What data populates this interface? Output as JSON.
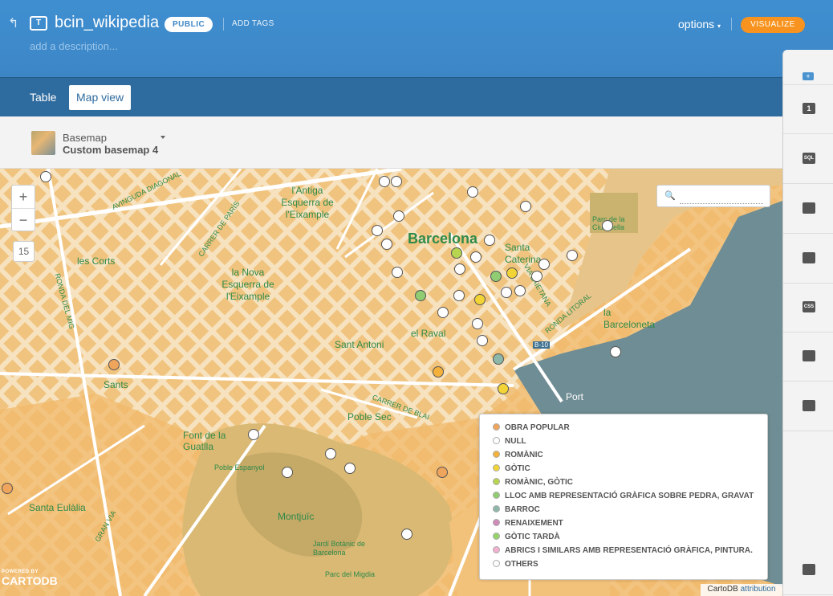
{
  "header": {
    "table_icon": "T",
    "title": "bcin_wikipedia",
    "privacy": "PUBLIC",
    "add_tags": "ADD TAGS",
    "description": "add a description...",
    "options": "options",
    "visualize": "VISUALIZE"
  },
  "tabs": [
    {
      "label": "Table"
    },
    {
      "label": "Map view"
    }
  ],
  "basemap": {
    "label": "Basemap",
    "name": "Custom basemap 4"
  },
  "map": {
    "zoom_in": "+",
    "zoom_out": "−",
    "zoom_level": "15",
    "search_placeholder": "",
    "labels": [
      "Barcelona",
      "l'Antiga Esquerra de l'Eixample",
      "la Nova Esquerra de l'Eixample",
      "les Corts",
      "Sants",
      "Sant Antoni",
      "el Raval",
      "Poble Sec",
      "Font de la Guatlla",
      "Montjuïc",
      "Santa Eulàlia",
      "la Barceloneta",
      "Santa Caterina",
      "Poble Espanyol",
      "Port",
      "Jardí Botànic de Barcelona",
      "Parc del Migdia",
      "AVINGUDA DIAGONAL",
      "RONDA DEL MIG",
      "CARRER DE PARÍS",
      "RONDA LITORAL",
      "VIA LAIETANA",
      "CARRER DE BLAI",
      "B-10",
      "GRAN VIA",
      "Parc de la Ciutadella"
    ],
    "attribution_prefix": "CartoDB",
    "attribution_link": "attribution",
    "powered_by": "POWERED BY",
    "brand": "CARTODB"
  },
  "legend": {
    "items": [
      {
        "label": "OBRA POPULAR",
        "color": "#f0a55d"
      },
      {
        "label": "NULL",
        "color": "#ffffff"
      },
      {
        "label": "ROMÀNIC",
        "color": "#f4b13b"
      },
      {
        "label": "GÒTIC",
        "color": "#f2d436"
      },
      {
        "label": "ROMÀNIC, GÒTIC",
        "color": "#b7d54f"
      },
      {
        "label": "LLOC AMB REPRESENTACIÓ GRÀFICA SOBRE PEDRA, GRAVAT",
        "color": "#8fcc72"
      },
      {
        "label": "BARROC",
        "color": "#8db7a9"
      },
      {
        "label": "RENAIXEMENT",
        "color": "#cf8bb8"
      },
      {
        "label": "GÒTIC TARDÀ",
        "color": "#96d36a"
      },
      {
        "label": "ABRICS I SIMILARS AMB REPRESENTACIÓ GRÀFICA, PINTURA.",
        "color": "#f2b1cf"
      },
      {
        "label": "OTHERS",
        "color": "#ffffff"
      }
    ]
  },
  "right_panel": {
    "buttons": [
      {
        "name": "add-layer",
        "label": "+"
      },
      {
        "name": "layer-1",
        "label": "1"
      },
      {
        "name": "sql",
        "label": "SQL"
      },
      {
        "name": "wizard",
        "label": ""
      },
      {
        "name": "infowindow",
        "label": ""
      },
      {
        "name": "css",
        "label": "CSS"
      },
      {
        "name": "legends",
        "label": ""
      },
      {
        "name": "filters",
        "label": ""
      },
      {
        "name": "layers",
        "label": ""
      }
    ]
  }
}
